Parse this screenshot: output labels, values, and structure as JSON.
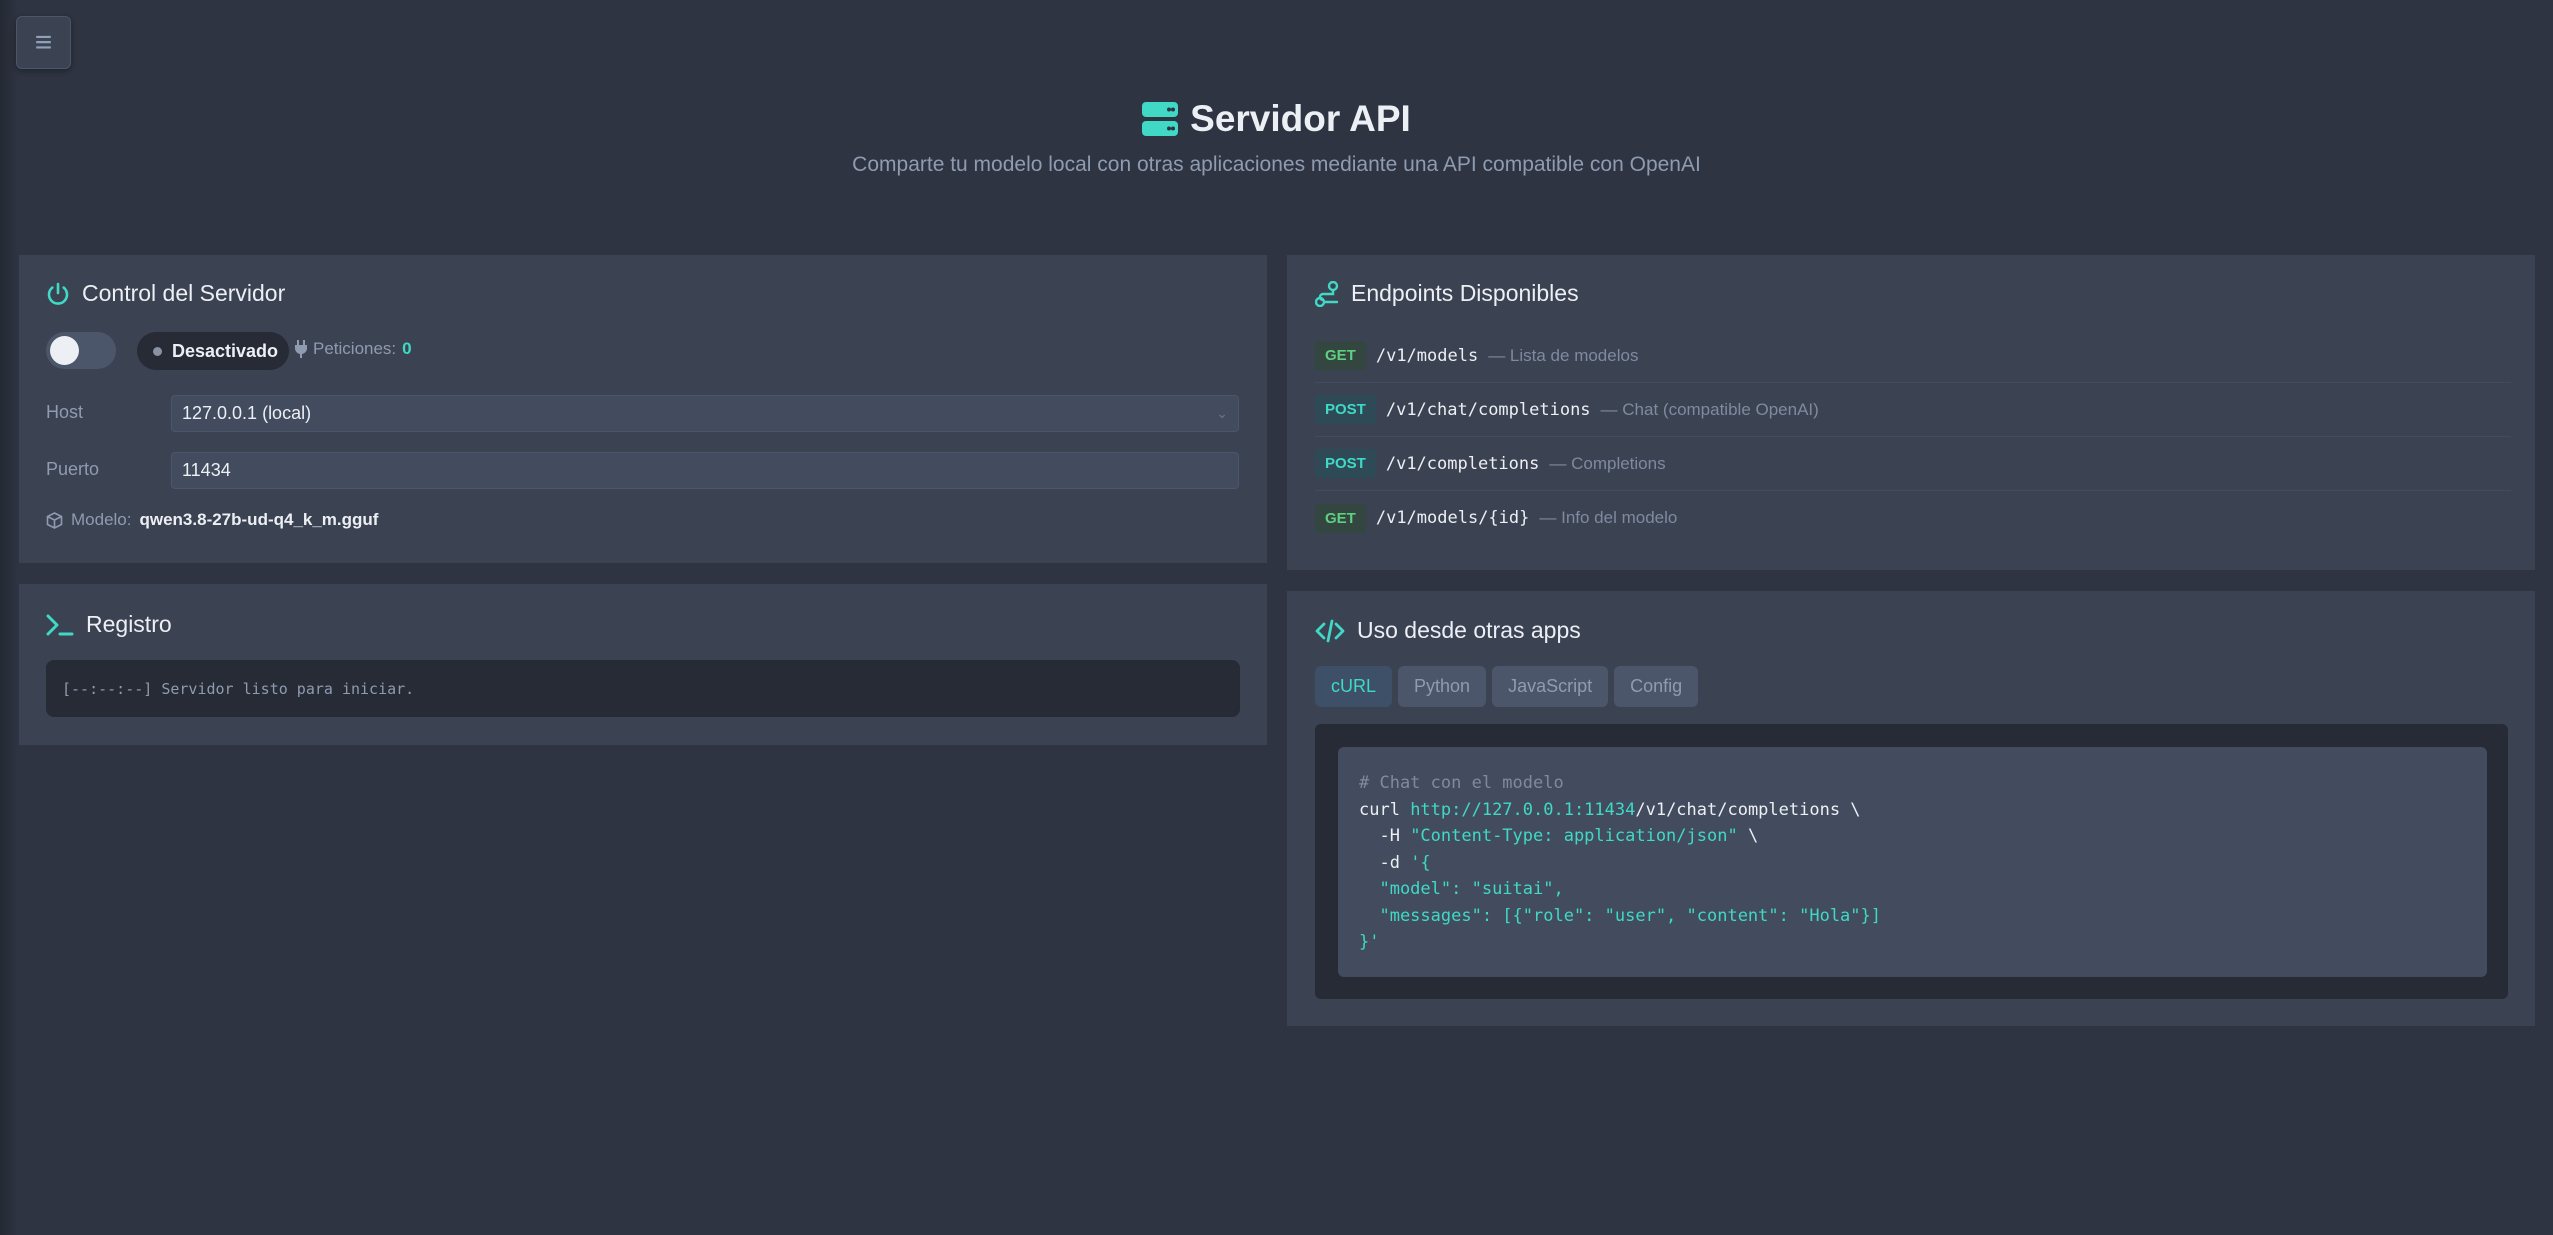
{
  "menu_button": {
    "icon": "≡"
  },
  "header": {
    "title": "Servidor API",
    "subtitle": "Comparte tu modelo local con otras aplicaciones mediante una API compatible con OpenAI"
  },
  "control": {
    "title": "Control del Servidor",
    "toggle_on": false,
    "status_label": "Desactivado",
    "requests_label": "Peticiones:",
    "requests_count": "0",
    "host_label": "Host",
    "host_value": "127.0.0.1 (local)",
    "port_label": "Puerto",
    "port_value": "11434",
    "model_label": "Modelo:",
    "model_value": "qwen3.8-27b-ud-q4_k_m.gguf"
  },
  "log": {
    "title": "Registro",
    "lines": [
      "[--:--:--] Servidor listo para iniciar."
    ]
  },
  "endpoints": {
    "title": "Endpoints Disponibles",
    "items": [
      {
        "method": "GET",
        "path": "/v1/models",
        "desc": "— Lista de modelos"
      },
      {
        "method": "POST",
        "path": "/v1/chat/completions",
        "desc": "— Chat (compatible OpenAI)"
      },
      {
        "method": "POST",
        "path": "/v1/completions",
        "desc": "— Completions"
      },
      {
        "method": "GET",
        "path": "/v1/models/{id}",
        "desc": "— Info del modelo"
      }
    ]
  },
  "usage": {
    "title": "Uso desde otras apps",
    "tabs": [
      "cURL",
      "Python",
      "JavaScript",
      "Config"
    ],
    "active_tab": "cURL",
    "code": {
      "comment": "# Chat con el modelo",
      "cmd": "curl ",
      "url": "http://127.0.0.1:11434",
      "path_cont": "/v1/chat/completions \\",
      "h_flag": "  -H ",
      "h_val": "\"Content-Type: application/json\"",
      "h_tail": " \\",
      "d_flag": "  -d ",
      "d_open": "'{",
      "model_key": "  \"model\": ",
      "model_val": "\"suitai\",",
      "messages_key": "  \"messages\": ",
      "messages_val": "[{\"role\": \"user\", \"content\": \"Hola\"}]",
      "close": "}'"
    }
  },
  "colors": {
    "accent": "#3fd9c6",
    "background": "#2e3441",
    "card": "#3b4252"
  }
}
